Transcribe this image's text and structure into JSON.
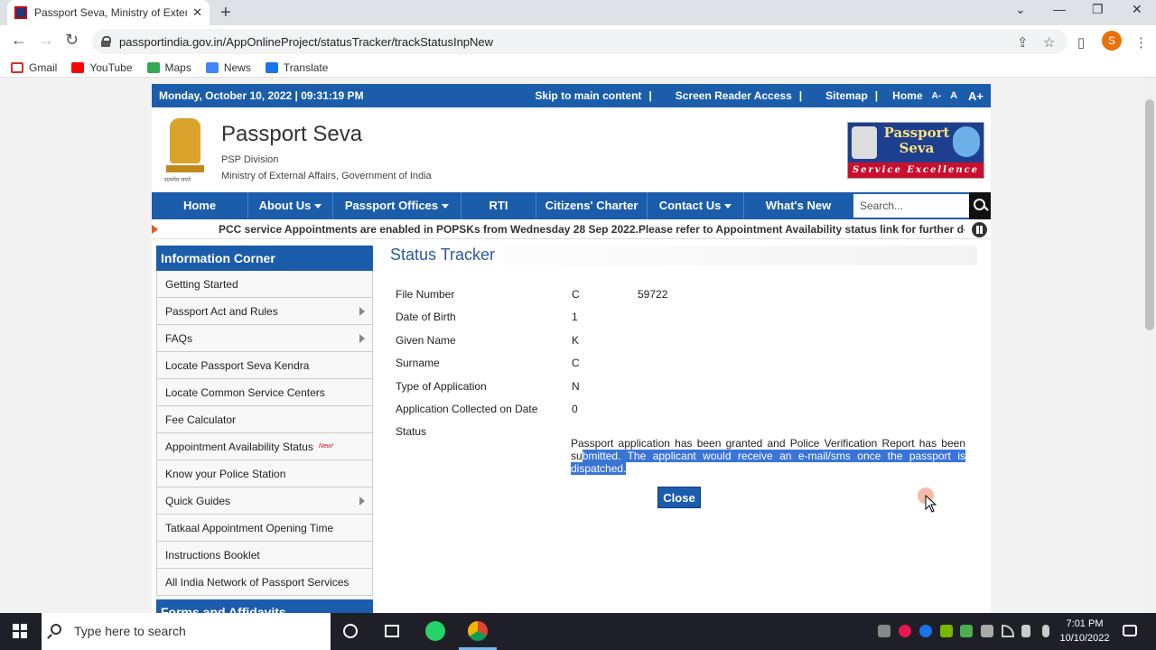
{
  "browser": {
    "tab_title": "Passport Seva, Ministry of Extern",
    "url": "passportindia.gov.in/AppOnlineProject/statusTracker/trackStatusInpNew",
    "profile_initial": "S",
    "bookmarks": [
      "Gmail",
      "YouTube",
      "Maps",
      "News",
      "Translate"
    ]
  },
  "site": {
    "datetime": "Monday, October 10, 2022 | 09:31:19 PM",
    "top_links": {
      "skip": "Skip to main content",
      "screen_reader": "Screen Reader Access",
      "sitemap": "Sitemap",
      "home": "Home",
      "font_small": "A-",
      "font_normal": "A",
      "font_large": "A+",
      "sep": "|"
    },
    "brand": {
      "title": "Passport Seva",
      "division": "PSP Division",
      "ministry": "Ministry of External Affairs, Government of India",
      "emblem_motto": "सत्यमेव जयते",
      "logo_line1": "Passport",
      "logo_line2": "Seva",
      "logo_tagline": "Service Excellence"
    },
    "nav": {
      "home": "Home",
      "about": "About Us",
      "offices": "Passport Offices",
      "rti": "RTI",
      "charter": "Citizens' Charter",
      "contact": "Contact Us",
      "whats_new": "What's New",
      "search_placeholder": "Search..."
    },
    "ticker": "PCC service Appointments are enabled in POPSKs from Wednesday 28 Sep 2022.Please refer to Appointment Availability status link for further details. \"\" P"
  },
  "sidebar": {
    "heading": "Information Corner",
    "items": [
      {
        "label": "Getting Started"
      },
      {
        "label": "Passport Act and Rules"
      },
      {
        "label": "FAQs"
      },
      {
        "label": "Locate Passport Seva Kendra"
      },
      {
        "label": "Locate Common Service Centers"
      },
      {
        "label": "Fee Calculator"
      },
      {
        "label": "Appointment Availability Status",
        "tag": "New!"
      },
      {
        "label": "Know your Police Station"
      },
      {
        "label": "Quick Guides"
      },
      {
        "label": "Tatkaal Appointment Opening Time"
      },
      {
        "label": "Instructions Booklet"
      },
      {
        "label": "All India Network of Passport Services"
      }
    ],
    "footer_heading": "Forms and Affidavits"
  },
  "tracker": {
    "title": "Status Tracker",
    "fields": {
      "file_number": {
        "label": "File Number",
        "value_start": "C",
        "value_end": "59722"
      },
      "dob": {
        "label": "Date of Birth",
        "value": "1"
      },
      "given_name": {
        "label": "Given Name",
        "value": "K"
      },
      "surname": {
        "label": "Surname",
        "value": "C"
      },
      "app_type": {
        "label": "Type of Application",
        "value": "N"
      },
      "collected": {
        "label": "Application Collected on Date",
        "value": "0"
      },
      "status": {
        "label": "Status"
      }
    },
    "status_plain": "Passport application has been granted and Police Verification Report has been su",
    "status_highlight": "bmitted. The applicant would receive an e-mail/sms once the passport is dispatched.",
    "close_label": "Close"
  },
  "taskbar": {
    "search_placeholder": "Type here to search",
    "time": "7:01 PM",
    "date": "10/10/2022"
  }
}
